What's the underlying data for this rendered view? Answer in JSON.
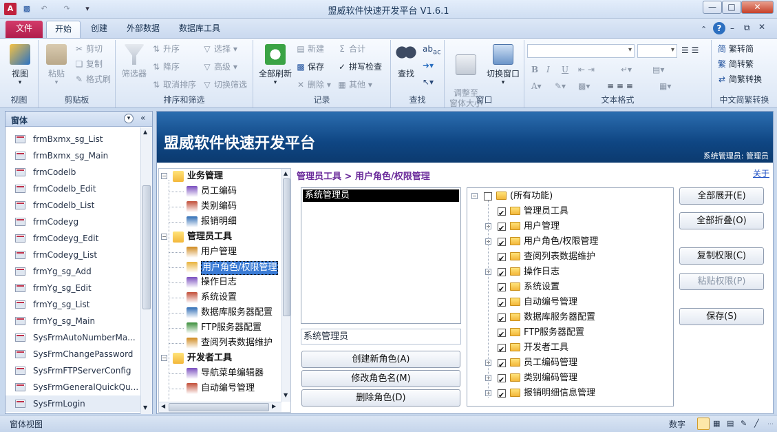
{
  "window": {
    "title": "盟威软件快速开发平台 V1.6.1"
  },
  "tabs": [
    {
      "label": "文件"
    },
    {
      "label": "开始"
    },
    {
      "label": "创建"
    },
    {
      "label": "外部数据"
    },
    {
      "label": "数据库工具"
    }
  ],
  "ribbon": {
    "view": {
      "label": "视图",
      "group": "视图"
    },
    "clipboard": {
      "paste": "粘贴",
      "cut": "剪切",
      "copy": "复制",
      "format_painter": "格式刷",
      "group": "剪贴板"
    },
    "sort": {
      "filter": "筛选器",
      "asc": "升序",
      "desc": "降序",
      "clear_sort": "取消排序",
      "selection": "选择",
      "advanced": "高级",
      "toggle_filter": "切换筛选",
      "group": "排序和筛选"
    },
    "records": {
      "refresh_all": "全部刷新",
      "new": "新建",
      "save": "保存",
      "delete": "删除",
      "totals": "合计",
      "spelling": "拼写检查",
      "more": "其他",
      "group": "记录"
    },
    "find": {
      "find": "查找",
      "group": "查找"
    },
    "window": {
      "fit": "调整至\n窗体大小",
      "switch": "切换窗口",
      "group": "窗口"
    },
    "text_format": {
      "bold": "B",
      "italic": "I",
      "underline": "U",
      "font_color": "A",
      "group": "文本格式"
    },
    "chinese": {
      "to_simplified": "繁转简",
      "to_traditional": "简转繁",
      "convert": "简繁转换",
      "group": "中文简繁转换"
    }
  },
  "nav": {
    "header": "窗体",
    "items": [
      "frmBxmx_sg_List",
      "frmBxmx_sg_Main",
      "frmCodelb",
      "frmCodelb_Edit",
      "frmCodelb_List",
      "frmCodeyg",
      "frmCodeyg_Edit",
      "frmCodeyg_List",
      "frmYg_sg_Add",
      "frmYg_sg_Edit",
      "frmYg_sg_List",
      "frmYg_sg_Main",
      "SysFrmAutoNumberMa...",
      "SysFrmChangePassword",
      "SysFrmFTPServerConfig",
      "SysFrmGeneralQuickQu...",
      "SysFrmLogin"
    ]
  },
  "banner": {
    "title": "盟威软件快速开发平台",
    "user": "系统管理员: 管理员"
  },
  "breadcrumb": "管理员工具 > 用户角色/权限管理",
  "about": "关于",
  "menu_tree": [
    {
      "label": "业务管理",
      "level": 0,
      "expanded": true
    },
    {
      "label": "员工编码",
      "level": 1
    },
    {
      "label": "类别编码",
      "level": 1
    },
    {
      "label": "报销明细",
      "level": 1
    },
    {
      "label": "管理员工具",
      "level": 0,
      "expanded": true
    },
    {
      "label": "用户管理",
      "level": 1
    },
    {
      "label": "用户角色/权限管理",
      "level": 1,
      "selected": true
    },
    {
      "label": "操作日志",
      "level": 1
    },
    {
      "label": "系统设置",
      "level": 1
    },
    {
      "label": "数据库服务器配置",
      "level": 1
    },
    {
      "label": "FTP服务器配置",
      "level": 1
    },
    {
      "label": "查阅列表数据维护",
      "level": 1
    },
    {
      "label": "开发者工具",
      "level": 0,
      "expanded": true
    },
    {
      "label": "导航菜单编辑器",
      "level": 1
    },
    {
      "label": "自动编号管理",
      "level": 1
    }
  ],
  "roles": {
    "items": [
      "系统管理员"
    ],
    "selected": "系统管理员",
    "name_value": "系统管理员"
  },
  "role_buttons": {
    "create": "创建新角色(A)",
    "rename": "修改角色名(M)",
    "delete": "删除角色(D)"
  },
  "perm_tree": [
    {
      "label": "(所有功能)",
      "root": true,
      "checked": false
    },
    {
      "label": "管理员工具",
      "checked": true,
      "expandable": false
    },
    {
      "label": "用户管理",
      "checked": true,
      "expandable": true
    },
    {
      "label": "用户角色/权限管理",
      "checked": true,
      "expandable": true
    },
    {
      "label": "查阅列表数据维护",
      "checked": true,
      "expandable": false
    },
    {
      "label": "操作日志",
      "checked": true,
      "expandable": true
    },
    {
      "label": "系统设置",
      "checked": true,
      "expandable": false
    },
    {
      "label": "自动编号管理",
      "checked": true,
      "expandable": false
    },
    {
      "label": "数据库服务器配置",
      "checked": true,
      "expandable": false
    },
    {
      "label": "FTP服务器配置",
      "checked": true,
      "expandable": false
    },
    {
      "label": "开发者工具",
      "checked": true,
      "expandable": false
    },
    {
      "label": "员工编码管理",
      "checked": true,
      "expandable": true
    },
    {
      "label": "类别编码管理",
      "checked": true,
      "expandable": true
    },
    {
      "label": "报销明细信息管理",
      "checked": true,
      "expandable": true
    }
  ],
  "actions": {
    "expand_all": "全部展开(E)",
    "collapse_all": "全部折叠(O)",
    "copy_perm": "复制权限(C)",
    "paste_perm": "粘贴权限(P)",
    "save": "保存(S)"
  },
  "status": {
    "left": "窗体视图",
    "mode": "数字"
  },
  "colors": {
    "accent": "#0f4683",
    "file_tab": "#b01d4c",
    "breadcrumb": "#6a2a9a"
  }
}
